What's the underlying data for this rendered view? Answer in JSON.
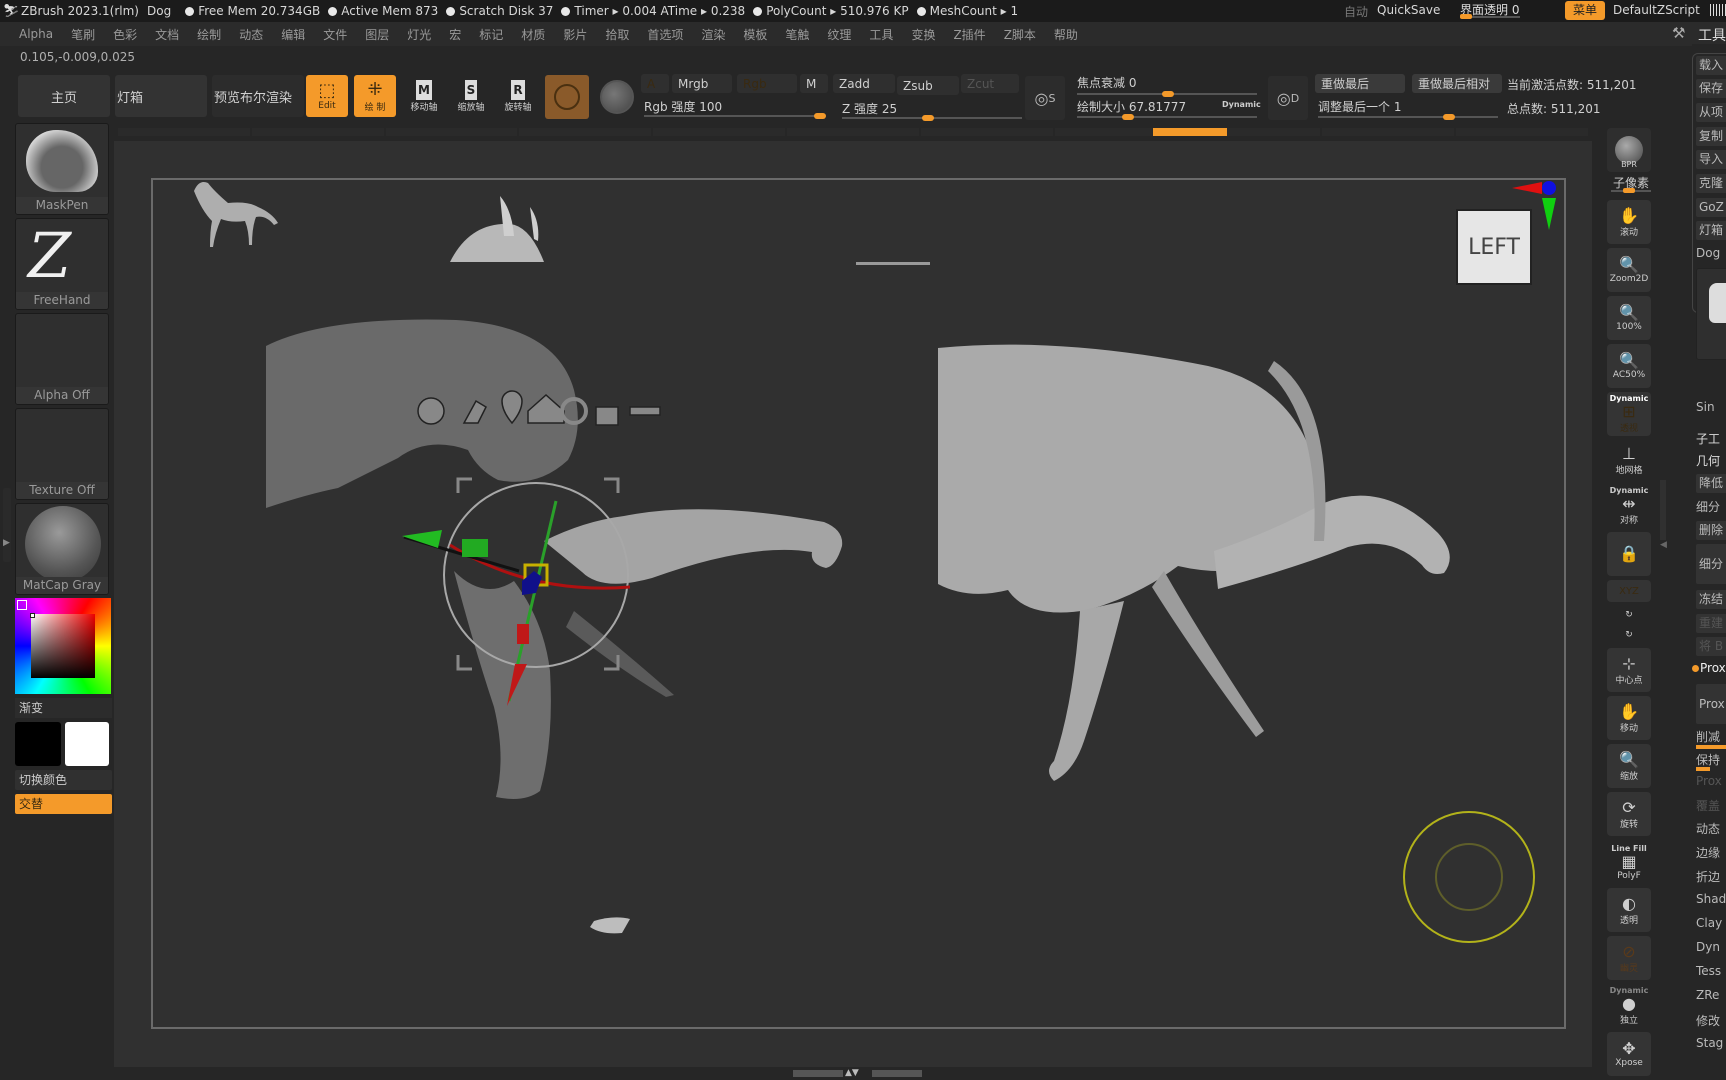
{
  "titlebar": {
    "app": "ZBrush 2023.1(rlm)",
    "document": "Dog",
    "stats": [
      "Free Mem 20.734GB",
      "Active Mem 873",
      "Scratch Disk 37",
      "Timer ▸ 0.004 ATime ▸ 0.238",
      "PolyCount ▸ 510.976 KP",
      "MeshCount ▸ 1"
    ],
    "auto_label": "自动",
    "quicksave": "QuickSave",
    "ui_transparency": "界面透明 0",
    "menu_button": "菜单",
    "default_zscript": "DefaultZScript"
  },
  "menubar": {
    "items": [
      "Alpha",
      "笔刷",
      "色彩",
      "文档",
      "绘制",
      "动态",
      "编辑",
      "文件",
      "图层",
      "灯光",
      "宏",
      "标记",
      "材质",
      "影片",
      "拾取",
      "首选项",
      "渲染",
      "模板",
      "笔触",
      "纹理",
      "工具",
      "变换",
      "Z插件",
      "Z脚本",
      "帮助"
    ]
  },
  "coordinates": "0.105,-0.009,0.025",
  "shelf": {
    "home": "主页",
    "lightbox": "灯箱",
    "live_boolean": "预览布尔渲染",
    "edit": "Edit",
    "draw": "绘 制",
    "move": "移动轴",
    "scale": "缩放轴",
    "rotate": "旋转轴",
    "move_key": "M",
    "scale_key": "S",
    "rotate_key": "R",
    "a": "A",
    "mrgb": "Mrgb",
    "rgb": "Rgb",
    "m": "M",
    "zadd": "Zadd",
    "zsub": "Zsub",
    "zcut": "Zcut",
    "rgb_intensity": "Rgb 强度 100",
    "rgb_intensity_value": 100,
    "z_intensity": "Z 强度 25",
    "z_intensity_value": 25,
    "focal_shift": "焦点衰减 0",
    "focal_shift_value": 0,
    "draw_size": "绘制大小 67.81777",
    "draw_size_value": 67.81777,
    "dynamic": "Dynamic",
    "s_key": "S",
    "d_key": "D",
    "redo_last": "重做最后",
    "redo_last_relative": "重做最后相对",
    "adjust_last": "调整最后一个 1",
    "adjust_last_value": 1,
    "active_points": "当前激活点数: 511,201",
    "total_points": "总点数: 511,201"
  },
  "leftpanel": {
    "brush": "MaskPen",
    "stroke": "FreeHand",
    "alpha": "Alpha Off",
    "texture": "Texture Off",
    "material": "MatCap Gray",
    "gradient": "渐变",
    "switch_color": "切换颜色",
    "alternate": "交替",
    "main_color": "#000000",
    "secondary_color": "#ffffff"
  },
  "viewport": {
    "view_label": "LEFT",
    "gizmo_icons": [
      "gear-icon",
      "pin-icon",
      "location-icon",
      "home-icon",
      "reset-icon",
      "lock-icon",
      "toggle-icon"
    ]
  },
  "righttoolbar": {
    "bpr": "BPR",
    "subpixel": "子像素",
    "scroll": "滚动",
    "zoom2d": "Zoom2D",
    "actual": "100%",
    "ac50": "AC50%",
    "persp_top": "Dynamic",
    "persp": "透视",
    "floor": "地网格",
    "sym_top": "Dynamic",
    "sym": "对称",
    "xyz": "XYZ",
    "center": "中心点",
    "move": "移动",
    "zoom": "缩放",
    "rotate": "旋转",
    "linefill_top": "Line Fill",
    "polyf": "PolyF",
    "transp": "透明",
    "ghost": "幽灵",
    "solo_top": "Dynamic",
    "solo": "独立",
    "xpose": "Xpose"
  },
  "rightpanel": {
    "title": "工具",
    "buttons": [
      "载入",
      "保存",
      "从项",
      "复制",
      "导入",
      "克隆",
      "GoZ",
      "灯箱"
    ],
    "tool_name": "Dog",
    "simple": "Sin",
    "subtool": "子工",
    "geometry": "几何",
    "items": [
      "降低",
      "细分",
      "删除",
      "细分",
      "冻结",
      "重建",
      "将 B",
      "Prox",
      "Prox",
      "削减",
      "保持",
      "Prox",
      "覆盖",
      "动态",
      "边缘",
      "折边",
      "Shad",
      "Clay",
      "Dyn",
      "Tess",
      "ZRe",
      "修改",
      "Stag"
    ]
  }
}
